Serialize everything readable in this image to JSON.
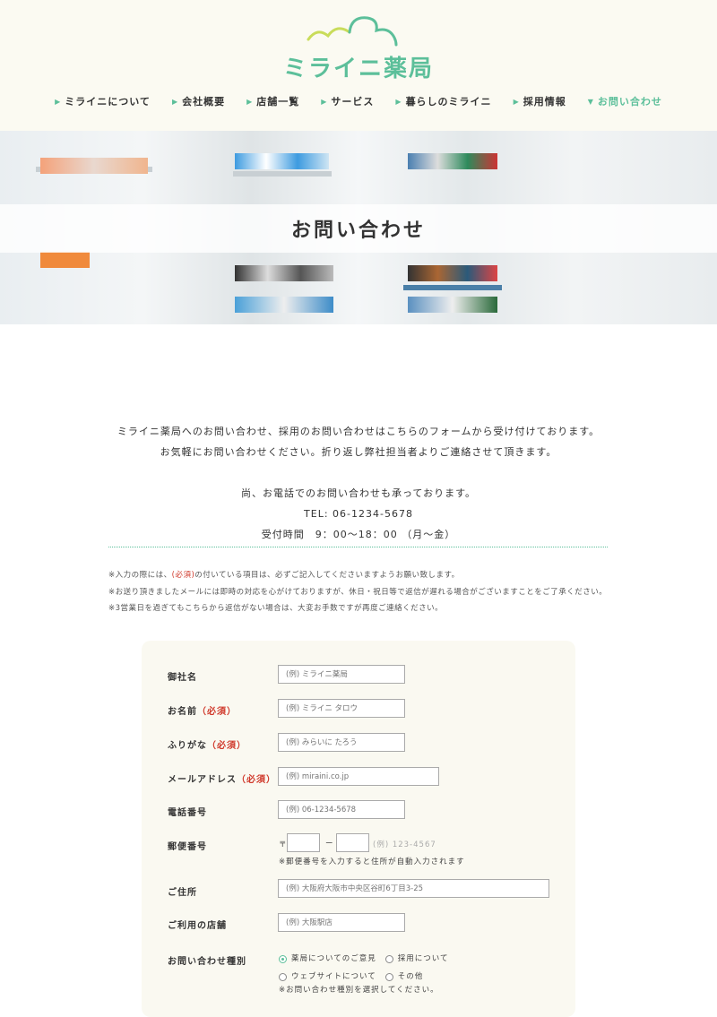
{
  "brand": {
    "name": "ミライニ薬局",
    "accent": "#5cbf9a",
    "cloud_color": "#c9dc5a"
  },
  "nav": [
    {
      "label": "ミライニについて"
    },
    {
      "label": "会社概要"
    },
    {
      "label": "店舗一覧"
    },
    {
      "label": "サービス"
    },
    {
      "label": "暮らしのミライニ"
    },
    {
      "label": "採用情報"
    },
    {
      "label": "お問い合わせ",
      "active": true
    }
  ],
  "hero": {
    "title": "お問い合わせ"
  },
  "intro": {
    "line1": "ミライニ薬局へのお問い合わせ、採用のお問い合わせはこちらのフォームから受け付けております。",
    "line2": "お気軽にお問い合わせください。折り返し弊社担当者よりご連絡させて頂きます。",
    "line3": "尚、お電話でのお問い合わせも承っております。",
    "tel": "TEL: 06-1234-5678",
    "hours": "受付時間　9：00〜18：00 （月〜金）"
  },
  "notes": {
    "n1_pre": "※入力の際には、",
    "n1_req": "(必須)",
    "n1_post": "の付いている項目は、必ずご記入してくださいますようお願い致します。",
    "n2": "※お送り頂きましたメールには即時の対応を心がけておりますが、休日・祝日等で返信が遅れる場合がございますことをご了承ください。",
    "n3": "※3営業日を過ぎてもこちらから返信がない場合は、大変お手数ですが再度ご連絡ください。"
  },
  "form": {
    "required": "（必須）",
    "company": {
      "label": "御社名",
      "placeholder": "(例) ミライニ薬局"
    },
    "name": {
      "label": "お名前",
      "placeholder": "(例) ミライニ タロウ"
    },
    "kana": {
      "label": "ふりがな",
      "placeholder": "(例) みらいに たろう"
    },
    "email": {
      "label": "メールアドレス",
      "placeholder": "(例) miraini.co.jp"
    },
    "phone": {
      "label": "電話番号",
      "placeholder": "(例) 06-1234-5678"
    },
    "zip": {
      "label": "郵便番号",
      "prefix": "〒",
      "sep": "ー",
      "example": "(例) 123-4567",
      "note": "※郵便番号を入力すると住所が自動入力されます"
    },
    "address": {
      "label": "ご住所",
      "placeholder": "(例) 大阪府大阪市中央区谷町6丁目3-25"
    },
    "store": {
      "label": "ご利用の店舗",
      "placeholder": "(例) 大阪駅店"
    },
    "type": {
      "label": "お問い合わせ種別",
      "options": [
        "薬局についてのご意見",
        "採用について",
        "ウェブサイトについて",
        "その他"
      ],
      "selected": "薬局についてのご意見",
      "note": "※お問い合わせ種別を選択してください。"
    }
  }
}
